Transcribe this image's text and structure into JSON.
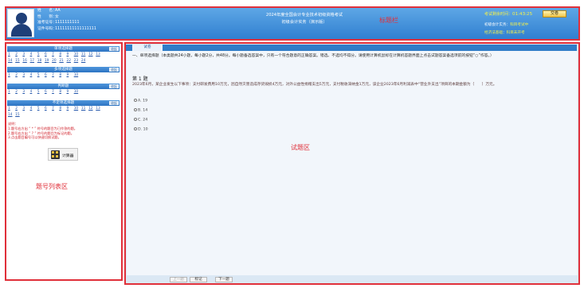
{
  "header": {
    "candidate": [
      {
        "label": "姓　　名：",
        "value": "AA"
      },
      {
        "label": "性　　别：",
        "value": "女"
      },
      {
        "label": "准考证号：",
        "value": "1111111111"
      },
      {
        "label": "证件号码：",
        "value": "11111111111111111"
      }
    ],
    "exam_title": "2024年度全国会计专业技术初级资格考试",
    "exam_subject": "初级会计实务（演示版）",
    "timer_label": "考试剩余时间：",
    "timer_value": "01:43:25",
    "submit_label": "交卷",
    "hint1_key": "初级会计实务",
    "hint1_value": "：",
    "hint1_extra": "科目考试中",
    "hint2_key": "经济法基础",
    "hint2_value": "：",
    "hint2_extra": "科目未开考",
    "annotation": "标题栏"
  },
  "left_panel": {
    "sections": [
      {
        "title": "单项选择题",
        "toggle": "收起",
        "rows": [
          [
            "1",
            "2",
            "3",
            "4",
            "5",
            "6",
            "7",
            "8",
            "9",
            "10",
            "11",
            "12",
            "13"
          ],
          [
            "14",
            "15",
            "16",
            "17",
            "18",
            "19",
            "20",
            "21",
            "22",
            "23",
            "24"
          ]
        ]
      },
      {
        "title": "多项选择题",
        "toggle": "收起",
        "rows": [
          [
            "1",
            "2",
            "3",
            "4",
            "5",
            "6",
            "7",
            "8",
            "9",
            "10"
          ]
        ]
      },
      {
        "title": "判断题",
        "toggle": "收起",
        "rows": [
          [
            "1",
            "2",
            "3",
            "4",
            "5",
            "6",
            "7",
            "8",
            "9",
            "10"
          ]
        ]
      },
      {
        "title": "不定项选择题",
        "toggle": "收起",
        "rows": [
          [
            "1",
            "2",
            "3",
            "4",
            "5",
            "6",
            "7",
            "8",
            "9",
            "10",
            "11",
            "12",
            "13",
            "14",
            "15"
          ]
        ]
      }
    ],
    "legend": [
      "说明：",
      "1.题号右方出 “ * ” 符号的题目为已作答的题。",
      "2.题号右方出 “ ? ” 符号的题目为标记的题。",
      "3.点击题目编号可以快速切换试题。"
    ],
    "calc_label": "计算器",
    "annotation": "题号列表区"
  },
  "right_panel": {
    "tab_label": "试卷",
    "instructions": "一、单项选择题（本类题共24小题，每小题2分，共48分。每小题备选答案中，只有一个符合题意的正确答案。错选、不选均不得分。请使用计算机鼠标在计算机答题界面上点击试题答案备选项前的按钮“○”作答。）",
    "question_number": "第 1 题",
    "question_text": "2023年6月，某企业发生以下事项：支付研发费用10万元，因自然灾害造成存货毁损4万元，对外公益性捐赠支出5万元，支付税收滞纳金1万元，该企业2023年6月利润表中“营业外支出”项目的本期金额为（　　）万元。",
    "options": [
      {
        "key": "A.",
        "text": "19"
      },
      {
        "key": "B.",
        "text": "14"
      },
      {
        "key": "C.",
        "text": "24"
      },
      {
        "key": "D.",
        "text": "10"
      }
    ],
    "nav_prev": "上一题",
    "nav_mark": "标记",
    "nav_next": "下一题",
    "annotation": "试题区"
  }
}
